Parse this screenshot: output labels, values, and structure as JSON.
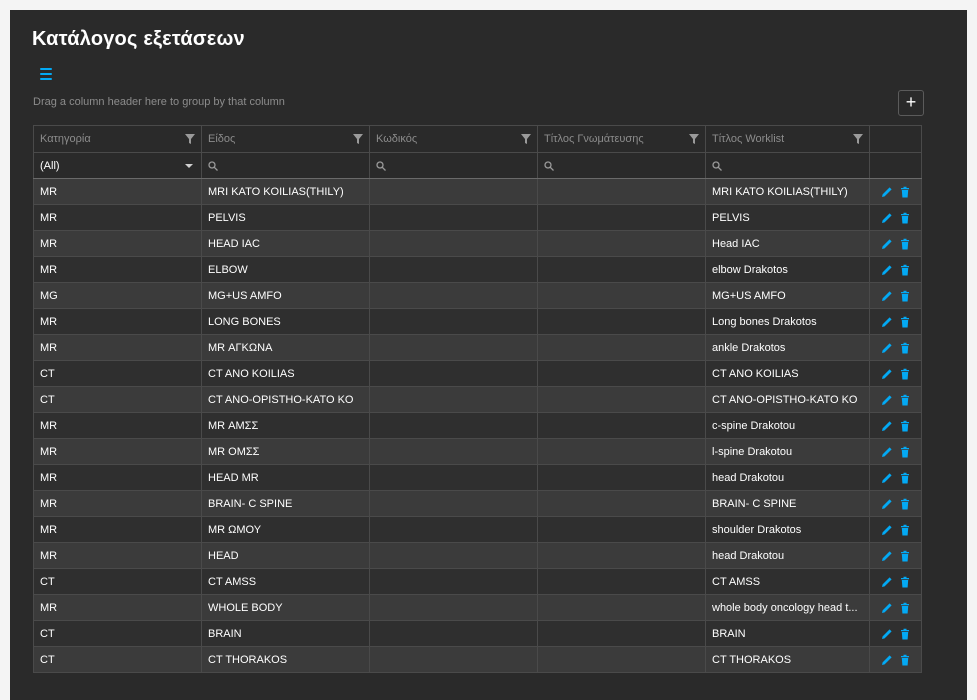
{
  "page": {
    "title": "Κατάλογος εξετάσεων",
    "group_panel_text": "Drag a column header here to group by that column",
    "add_label": "+"
  },
  "colors": {
    "background": "#2a2a2a",
    "accent": "#03a9f4",
    "row_odd": "#3b3b3b",
    "row_even": "#2f2f2f",
    "header_text": "#8c8c8c"
  },
  "grid": {
    "columns": [
      "Κατηγορία",
      "Είδος",
      "Κωδικός",
      "Τίτλος Γνωμάτευσης",
      "Τίτλος Worklist"
    ],
    "category_filter": "(All)",
    "rows": [
      [
        "MR",
        "MRI KATO KOILIAS(THILY)",
        "",
        "",
        "MRI KATO KOILIAS(THILY)"
      ],
      [
        "MR",
        "PELVIS",
        "",
        "",
        "PELVIS"
      ],
      [
        "MR",
        "HEAD IAC",
        "",
        "",
        "Head IAC"
      ],
      [
        "MR",
        "ELBOW",
        "",
        "",
        "elbow Drakotos"
      ],
      [
        "MG",
        "MG+US AMFO",
        "",
        "",
        "MG+US AMFO"
      ],
      [
        "MR",
        "LONG BONES",
        "",
        "",
        "Long bones Drakotos"
      ],
      [
        "MR",
        "MR ΑΓΚΩΝΑ",
        "",
        "",
        "ankle Drakotos"
      ],
      [
        "CT",
        "CT ANO KOILIAS",
        "",
        "",
        "CT ANO KOILIAS"
      ],
      [
        "CT",
        "CT ANO-OPISTHO-KATO KO",
        "",
        "",
        "CT ANO-OPISTHO-KATO KO"
      ],
      [
        "MR",
        "MR ΑΜΣΣ",
        "",
        "",
        "c-spine Drakotou"
      ],
      [
        "MR",
        "MR ΟΜΣΣ",
        "",
        "",
        "l-spine Drakotou"
      ],
      [
        "MR",
        "HEAD MR",
        "",
        "",
        "head Drakotou"
      ],
      [
        "MR",
        "BRAIN- C SPINE",
        "",
        "",
        "BRAIN- C SPINE"
      ],
      [
        "MR",
        "MR ΩΜΟΥ",
        "",
        "",
        "shoulder Drakotos"
      ],
      [
        "MR",
        "HEAD",
        "",
        "",
        "head Drakotou"
      ],
      [
        "CT",
        "CT AMSS",
        "",
        "",
        "CT AMSS"
      ],
      [
        "MR",
        "WHOLE BODY",
        "",
        "",
        "whole body oncology head t..."
      ],
      [
        "CT",
        "BRAIN",
        "",
        "",
        "BRAIN"
      ],
      [
        "CT",
        "CT THORAKOS",
        "",
        "",
        "CT THORAKOS"
      ]
    ]
  }
}
